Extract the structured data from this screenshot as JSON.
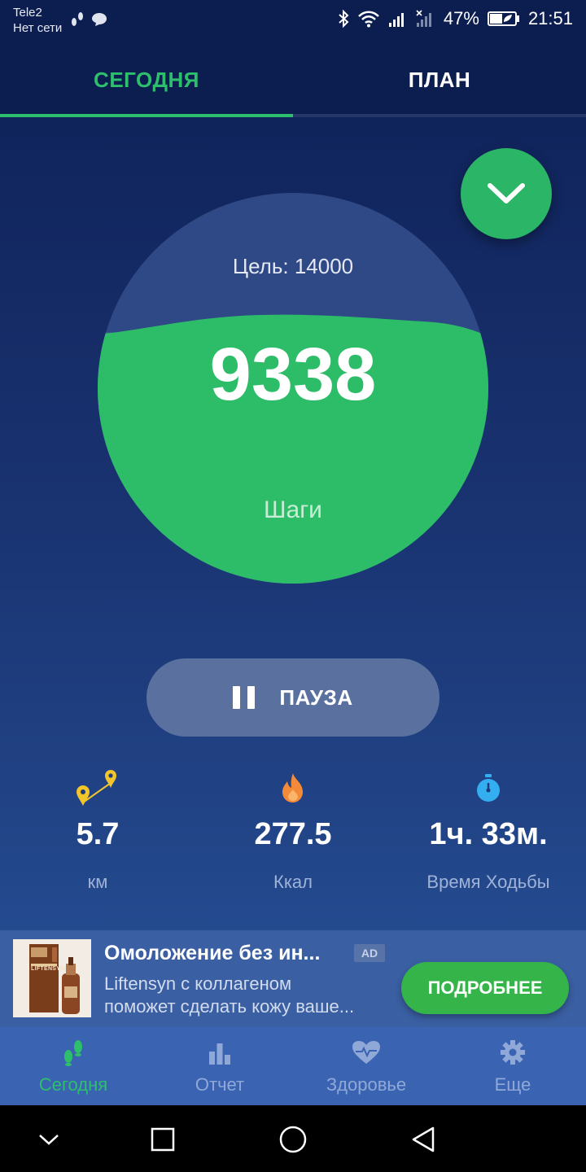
{
  "status_bar": {
    "carrier": "Tele2",
    "network": "Нет сети",
    "battery": "47%",
    "time": "21:51"
  },
  "tabs": [
    {
      "label": "СЕГОДНЯ",
      "active": true
    },
    {
      "label": "ПЛАН",
      "active": false
    }
  ],
  "fab": {
    "icon": "chevron-down-icon"
  },
  "progress": {
    "goal_text": "Цель: 14000",
    "steps": "9338",
    "steps_label": "Шаги",
    "fill_fraction": 0.667
  },
  "pause_button": {
    "label": "ПАУЗА",
    "icon": "pause-icon"
  },
  "stats": [
    {
      "icon": "route-icon",
      "value": "5.7",
      "label": "км"
    },
    {
      "icon": "flame-icon",
      "value": "277.5",
      "label": "Ккал"
    },
    {
      "icon": "stopwatch-icon",
      "value": "1ч. 33м.",
      "label": "Время Ходьбы"
    }
  ],
  "ad": {
    "title": "Омоложение без ин...",
    "badge": "AD",
    "description_line1": "Liftensyn с коллагеном",
    "description_line2": "поможет сделать кожу ваше...",
    "button": "ПОДРОБНЕЕ",
    "image_brand": "LIFTENSYN"
  },
  "bottom_nav": [
    {
      "label": "Сегодня",
      "icon": "footsteps-icon",
      "active": true
    },
    {
      "label": "Отчет",
      "icon": "bar-chart-icon",
      "active": false
    },
    {
      "label": "Здоровье",
      "icon": "heart-pulse-icon",
      "active": false
    },
    {
      "label": "Еще",
      "icon": "gear-icon",
      "active": false
    }
  ],
  "colors": {
    "accent": "#2dbf6c",
    "background_top": "#0d1f55",
    "background_bottom": "#2a57a0",
    "ad_button": "#35b549"
  }
}
